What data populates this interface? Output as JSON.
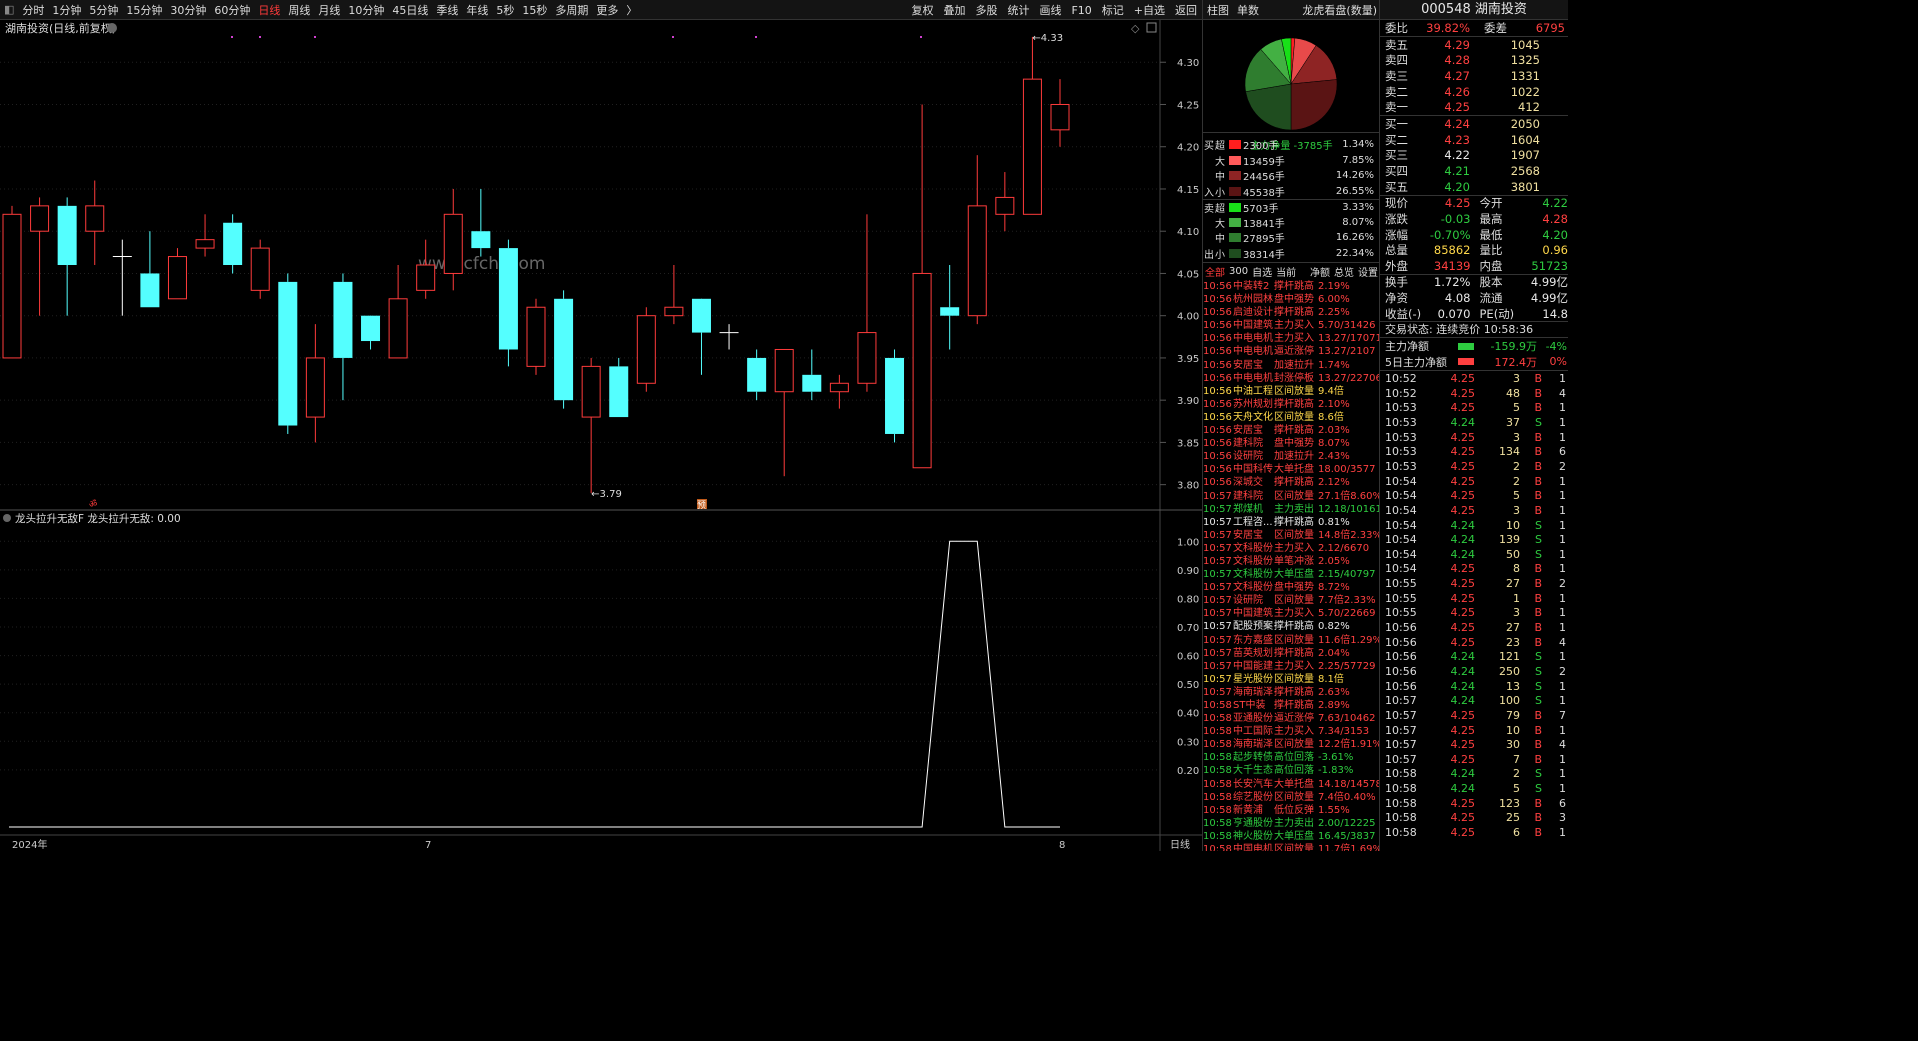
{
  "toolbar": {
    "left": [
      "分时",
      "1分钟",
      "5分钟",
      "15分钟",
      "30分钟",
      "60分钟",
      "日线",
      "周线",
      "月线",
      "10分钟",
      "45日线",
      "季线",
      "年线",
      "5秒",
      "15秒",
      "多周期",
      "更多"
    ],
    "active": "日线",
    "right": [
      "复权",
      "叠加",
      "多股",
      "统计",
      "画线",
      "F10",
      "标记",
      "+自选",
      "返回"
    ]
  },
  "chart": {
    "title": "湖南投资(日线,前复权)",
    "watermark": "www.cfchi.com",
    "price_ticks": [
      "4.30",
      "4.25",
      "4.20",
      "4.15",
      "4.10",
      "4.05",
      "4.00",
      "3.95",
      "3.90",
      "3.85",
      "3.80"
    ],
    "high_label": "4.33",
    "low_label": "3.79",
    "marker": "预",
    "indicator_title": "龙头拉升无敌F  龙头拉升无敌: 0.00",
    "indicator_ticks": [
      "1.00",
      "0.90",
      "0.80",
      "0.70",
      "0.60",
      "0.50",
      "0.40",
      "0.30",
      "0.20"
    ],
    "x_labels": [
      "2024年",
      "7",
      "8"
    ],
    "period": "日线"
  },
  "chart_data": [
    {
      "type": "candlestick",
      "title": "湖南投资(日线,前复权)",
      "ylim": [
        3.77,
        4.35
      ],
      "x_labels": [
        "2024年",
        "7",
        "8"
      ],
      "candles": [
        [
          3.95,
          4.12,
          4.13,
          3.95
        ],
        [
          4.1,
          4.13,
          4.14,
          4.0
        ],
        [
          4.13,
          4.06,
          4.14,
          4.0
        ],
        [
          4.1,
          4.13,
          4.16,
          4.06
        ],
        [
          4.07,
          4.07,
          4.09,
          4.0
        ],
        [
          4.05,
          4.01,
          4.1,
          4.01
        ],
        [
          4.02,
          4.07,
          4.08,
          4.02
        ],
        [
          4.08,
          4.09,
          4.12,
          4.07
        ],
        [
          4.11,
          4.06,
          4.12,
          4.05
        ],
        [
          4.03,
          4.08,
          4.09,
          4.02
        ],
        [
          4.04,
          3.87,
          4.05,
          3.86
        ],
        [
          3.88,
          3.95,
          3.99,
          3.85
        ],
        [
          4.04,
          3.95,
          4.05,
          3.9
        ],
        [
          4.0,
          3.97,
          3.98,
          3.96
        ],
        [
          3.95,
          4.02,
          4.06,
          3.95
        ],
        [
          4.03,
          4.06,
          4.09,
          4.02
        ],
        [
          4.05,
          4.12,
          4.15,
          4.03
        ],
        [
          4.1,
          4.08,
          4.15,
          4.07
        ],
        [
          4.08,
          3.96,
          4.09,
          3.94
        ],
        [
          3.94,
          4.01,
          4.02,
          3.93
        ],
        [
          4.02,
          3.9,
          4.03,
          3.89
        ],
        [
          3.88,
          3.94,
          3.95,
          3.79
        ],
        [
          3.94,
          3.88,
          3.95,
          3.88
        ],
        [
          3.92,
          4.0,
          4.01,
          3.91
        ],
        [
          4.0,
          4.01,
          4.06,
          3.99
        ],
        [
          4.02,
          3.98,
          4.01,
          3.93
        ],
        [
          3.98,
          3.98,
          3.99,
          3.96
        ],
        [
          3.95,
          3.91,
          3.96,
          3.9
        ],
        [
          3.91,
          3.96,
          3.96,
          3.81
        ],
        [
          3.93,
          3.91,
          3.96,
          3.9
        ],
        [
          3.91,
          3.92,
          3.93,
          3.89
        ],
        [
          3.92,
          3.98,
          4.12,
          3.91
        ],
        [
          3.95,
          3.86,
          3.96,
          3.85
        ],
        [
          3.82,
          4.05,
          4.25,
          3.82
        ],
        [
          4.01,
          4.0,
          4.06,
          3.96
        ],
        [
          4.0,
          4.13,
          4.19,
          3.99
        ],
        [
          4.12,
          4.14,
          4.17,
          4.1
        ],
        [
          4.12,
          4.28,
          4.33,
          4.12
        ],
        [
          4.22,
          4.25,
          4.28,
          4.2
        ]
      ]
    },
    {
      "type": "line",
      "title": "龙头拉升无敌F",
      "ylim": [
        0,
        1.05
      ],
      "values": [
        0,
        0,
        0,
        0,
        0,
        0,
        0,
        0,
        0,
        0,
        0,
        0,
        0,
        0,
        0,
        0,
        0,
        0,
        0,
        0,
        0,
        0,
        0,
        0,
        0,
        0,
        0,
        0,
        0,
        0,
        0,
        0,
        0,
        0,
        1,
        1,
        0,
        0,
        0
      ]
    }
  ],
  "right": {
    "tabs": [
      "柱图",
      "单数"
    ],
    "tab_right": "龙虎看盘(数量)",
    "pie_caption": "主力净量 -3785手",
    "pie": {
      "slices": [
        {
          "v": 1.34,
          "c": "#ff2020"
        },
        {
          "v": 7.85,
          "c": "#e84a4a"
        },
        {
          "v": 14.26,
          "c": "#8e2424"
        },
        {
          "v": 26.55,
          "c": "#5a1414"
        },
        {
          "v": 22.34,
          "c": "#1f4d1f"
        },
        {
          "v": 16.26,
          "c": "#2f7d2f"
        },
        {
          "v": 8.07,
          "c": "#43b043"
        },
        {
          "v": 3.33,
          "c": "#18e018"
        }
      ]
    },
    "flow": [
      {
        "side": "买",
        "k": "超",
        "v": "2300手",
        "p": "1.34%",
        "c": "#ff1e1e"
      },
      {
        "side": "",
        "k": "大",
        "v": "13459手",
        "p": "7.85%",
        "c": "#ff5a5a"
      },
      {
        "side": "",
        "k": "中",
        "v": "24456手",
        "p": "14.26%",
        "c": "#8e2424"
      },
      {
        "side": "入",
        "k": "小",
        "v": "45538手",
        "p": "26.55%",
        "c": "#5a1414"
      },
      {
        "side": "卖",
        "k": "超",
        "v": "5703手",
        "p": "3.33%",
        "c": "#18e018"
      },
      {
        "side": "",
        "k": "大",
        "v": "13841手",
        "p": "8.07%",
        "c": "#43b043"
      },
      {
        "side": "",
        "k": "中",
        "v": "27895手",
        "p": "16.26%",
        "c": "#2f7d2f"
      },
      {
        "side": "出",
        "k": "小",
        "v": "38314手",
        "p": "22.34%",
        "c": "#1f4d1f"
      }
    ],
    "news_tabs": [
      "全部",
      "300",
      "自选",
      "当前",
      "净额",
      "总览",
      "设置"
    ],
    "news": [
      [
        "10:56",
        "中装转2",
        "撑杆跳高",
        "2.19%",
        "red"
      ],
      [
        "10:56",
        "杭州园林",
        "盘中强势",
        "6.00%",
        "red"
      ],
      [
        "10:56",
        "启迪设计",
        "撑杆跳高",
        "2.25%",
        "red"
      ],
      [
        "10:56",
        "中国建筑",
        "主力买入",
        "5.70/31426",
        "red"
      ],
      [
        "10:56",
        "中电电机",
        "主力买入",
        "13.27/17071",
        "red"
      ],
      [
        "10:56",
        "中电电机",
        "逼近涨停",
        "13.27/2107",
        "red"
      ],
      [
        "10:56",
        "安居宝",
        "加速拉升",
        "1.74%",
        "red"
      ],
      [
        "10:56",
        "中电电机",
        "封涨停板",
        "13.27/22706",
        "red"
      ],
      [
        "10:56",
        "中油工程",
        "区间放量",
        "9.4倍",
        "yellow"
      ],
      [
        "10:56",
        "苏州规划",
        "撑杆跳高",
        "2.10%",
        "red"
      ],
      [
        "10:56",
        "天舟文化",
        "区间放量",
        "8.6倍",
        "yellow"
      ],
      [
        "10:56",
        "安居宝",
        "撑杆跳高",
        "2.03%",
        "red"
      ],
      [
        "10:56",
        "建科院",
        "盘中强势",
        "8.07%",
        "red"
      ],
      [
        "10:56",
        "设研院",
        "加速拉升",
        "2.43%",
        "red"
      ],
      [
        "10:56",
        "中国科传",
        "大单托盘",
        "18.00/3577",
        "red"
      ],
      [
        "10:56",
        "深城交",
        "撑杆跳高",
        "2.12%",
        "red"
      ],
      [
        "10:57",
        "建科院",
        "区间放量",
        "27.1倍8.60%",
        "red"
      ],
      [
        "10:57",
        "郑煤机",
        "主力卖出",
        "12.18/10161",
        "green"
      ],
      [
        "10:57",
        "工程咨...",
        "撑杆跳高",
        "0.81%",
        "white"
      ],
      [
        "10:57",
        "安居宝",
        "区间放量",
        "14.8倍2.33%",
        "red"
      ],
      [
        "10:57",
        "文科股份",
        "主力买入",
        "2.12/6670",
        "red"
      ],
      [
        "10:57",
        "文科股份",
        "单笔冲涨",
        "2.05%",
        "red"
      ],
      [
        "10:57",
        "文科股份",
        "大单压盘",
        "2.15/40797",
        "green"
      ],
      [
        "10:57",
        "文科股份",
        "盘中强势",
        "8.72%",
        "red"
      ],
      [
        "10:57",
        "设研院",
        "区间放量",
        "7.7倍2.33%",
        "red"
      ],
      [
        "10:57",
        "中国建筑",
        "主力买入",
        "5.70/22669",
        "red"
      ],
      [
        "10:57",
        "配股预案",
        "撑杆跳高",
        "0.82%",
        "white"
      ],
      [
        "10:57",
        "东方嘉盛",
        "区间放量",
        "11.6倍1.29%",
        "red"
      ],
      [
        "10:57",
        "苗英规划",
        "撑杆跳高",
        "2.04%",
        "red"
      ],
      [
        "10:57",
        "中国能建",
        "主力买入",
        "2.25/57729",
        "red"
      ],
      [
        "10:57",
        "星光股份",
        "区间放量",
        "8.1倍",
        "yellow"
      ],
      [
        "10:57",
        "海南瑞泽",
        "撑杆跳高",
        "2.63%",
        "red"
      ],
      [
        "10:58",
        "ST中装",
        "撑杆跳高",
        "2.89%",
        "red"
      ],
      [
        "10:58",
        "亚通股份",
        "逼近涨停",
        "7.63/10462",
        "red"
      ],
      [
        "10:58",
        "中工国际",
        "主力买入",
        "7.34/3153",
        "red"
      ],
      [
        "10:58",
        "海南瑞泽",
        "区间放量",
        "12.2倍1.91%",
        "red"
      ],
      [
        "10:58",
        "起步转债",
        "高位回落",
        "-3.61%",
        "green"
      ],
      [
        "10:58",
        "大千生态",
        "高位回落",
        "-1.83%",
        "green"
      ],
      [
        "10:58",
        "长安汽车",
        "大单托盘",
        "14.18/14578",
        "red"
      ],
      [
        "10:58",
        "综艺股份",
        "区间放量",
        "7.4倍0.40%",
        "red"
      ],
      [
        "10:58",
        "新黄浦",
        "低位反弹",
        "1.55%",
        "red"
      ],
      [
        "10:58",
        "亨通股份",
        "主力卖出",
        "2.00/12225",
        "green"
      ],
      [
        "10:58",
        "神火股份",
        "大单压盘",
        "16.45/3837",
        "green"
      ],
      [
        "10:58",
        "中国电机",
        "区间放量",
        "11.7倍1.69%",
        "red"
      ]
    ]
  },
  "quote": {
    "title": "000548 湖南投资",
    "wb": {
      "label": "委比",
      "value": "39.82%",
      "label2": "委差",
      "value2": "6795"
    },
    "asks": [
      {
        "l": "卖五",
        "p": "4.29",
        "v": "1045",
        "c": "red"
      },
      {
        "l": "卖四",
        "p": "4.28",
        "v": "1325",
        "c": "red"
      },
      {
        "l": "卖三",
        "p": "4.27",
        "v": "1331",
        "c": "red"
      },
      {
        "l": "卖二",
        "p": "4.26",
        "v": "1022",
        "c": "red"
      },
      {
        "l": "卖一",
        "p": "4.25",
        "v": "412",
        "c": "red"
      }
    ],
    "bids": [
      {
        "l": "买一",
        "p": "4.24",
        "v": "2050",
        "c": "red"
      },
      {
        "l": "买二",
        "p": "4.23",
        "v": "1604",
        "c": "red"
      },
      {
        "l": "买三",
        "p": "4.22",
        "v": "1907",
        "c": "white"
      },
      {
        "l": "买四",
        "p": "4.21",
        "v": "2568",
        "c": "green"
      },
      {
        "l": "买五",
        "p": "4.20",
        "v": "3801",
        "c": "green"
      }
    ],
    "stats": [
      {
        "a": "现价",
        "b": "4.25",
        "bc": "red",
        "c": "今开",
        "d": "4.22",
        "dc": "green"
      },
      {
        "a": "涨跌",
        "b": "-0.03",
        "bc": "green",
        "c": "最高",
        "d": "4.28",
        "dc": "red"
      },
      {
        "a": "涨幅",
        "b": "-0.70%",
        "bc": "green",
        "c": "最低",
        "d": "4.20",
        "dc": "green"
      },
      {
        "a": "总量",
        "b": "85862",
        "bc": "yellow",
        "c": "量比",
        "d": "0.96",
        "dc": "yellow"
      },
      {
        "a": "外盘",
        "b": "34139",
        "bc": "red",
        "c": "内盘",
        "d": "51723",
        "dc": "green"
      }
    ],
    "stats2": [
      {
        "a": "换手",
        "b": "1.72%",
        "bc": "white",
        "c": "股本",
        "d": "4.99亿",
        "dc": "white"
      },
      {
        "a": "净资",
        "b": "4.08",
        "bc": "white",
        "c": "流通",
        "d": "4.99亿",
        "dc": "white"
      },
      {
        "a": "收益(-)",
        "b": "0.070",
        "bc": "white",
        "c": "PE(动)",
        "d": "14.8",
        "dc": "white"
      }
    ],
    "status": "交易状态: 连续竞价 10:58:36",
    "mainflow": [
      {
        "a": "主力净额",
        "b": "-159.9万",
        "c": "-4%",
        "bar": "#2ecc40",
        "col": "green"
      },
      {
        "a": "5日主力净额",
        "b": "172.4万",
        "c": "0%",
        "bar": "#ff4040",
        "col": "red"
      }
    ],
    "ticks": [
      [
        "10:52",
        "4.25",
        "3",
        "B",
        "1"
      ],
      [
        "10:52",
        "4.25",
        "48",
        "B",
        "4"
      ],
      [
        "10:53",
        "4.25",
        "5",
        "B",
        "1"
      ],
      [
        "10:53",
        "4.24",
        "37",
        "S",
        "1"
      ],
      [
        "10:53",
        "4.25",
        "3",
        "B",
        "1"
      ],
      [
        "10:53",
        "4.25",
        "134",
        "B",
        "6"
      ],
      [
        "10:53",
        "4.25",
        "2",
        "B",
        "2"
      ],
      [
        "10:54",
        "4.25",
        "2",
        "B",
        "1"
      ],
      [
        "10:54",
        "4.25",
        "5",
        "B",
        "1"
      ],
      [
        "10:54",
        "4.25",
        "3",
        "B",
        "1"
      ],
      [
        "10:54",
        "4.24",
        "10",
        "S",
        "1"
      ],
      [
        "10:54",
        "4.24",
        "139",
        "S",
        "1"
      ],
      [
        "10:54",
        "4.24",
        "50",
        "S",
        "1"
      ],
      [
        "10:54",
        "4.25",
        "8",
        "B",
        "1"
      ],
      [
        "10:55",
        "4.25",
        "27",
        "B",
        "2"
      ],
      [
        "10:55",
        "4.25",
        "1",
        "B",
        "1"
      ],
      [
        "10:55",
        "4.25",
        "3",
        "B",
        "1"
      ],
      [
        "10:56",
        "4.25",
        "27",
        "B",
        "1"
      ],
      [
        "10:56",
        "4.25",
        "23",
        "B",
        "4"
      ],
      [
        "10:56",
        "4.24",
        "121",
        "S",
        "1"
      ],
      [
        "10:56",
        "4.24",
        "250",
        "S",
        "2"
      ],
      [
        "10:56",
        "4.24",
        "13",
        "S",
        "1"
      ],
      [
        "10:57",
        "4.24",
        "100",
        "S",
        "1"
      ],
      [
        "10:57",
        "4.25",
        "79",
        "B",
        "7"
      ],
      [
        "10:57",
        "4.25",
        "10",
        "B",
        "1"
      ],
      [
        "10:57",
        "4.25",
        "30",
        "B",
        "4"
      ],
      [
        "10:57",
        "4.25",
        "7",
        "B",
        "1"
      ],
      [
        "10:58",
        "4.24",
        "2",
        "S",
        "1"
      ],
      [
        "10:58",
        "4.24",
        "5",
        "S",
        "1"
      ],
      [
        "10:58",
        "4.25",
        "123",
        "B",
        "6"
      ],
      [
        "10:58",
        "4.25",
        "25",
        "B",
        "3"
      ],
      [
        "10:58",
        "4.25",
        "6",
        "B",
        "1"
      ]
    ]
  }
}
